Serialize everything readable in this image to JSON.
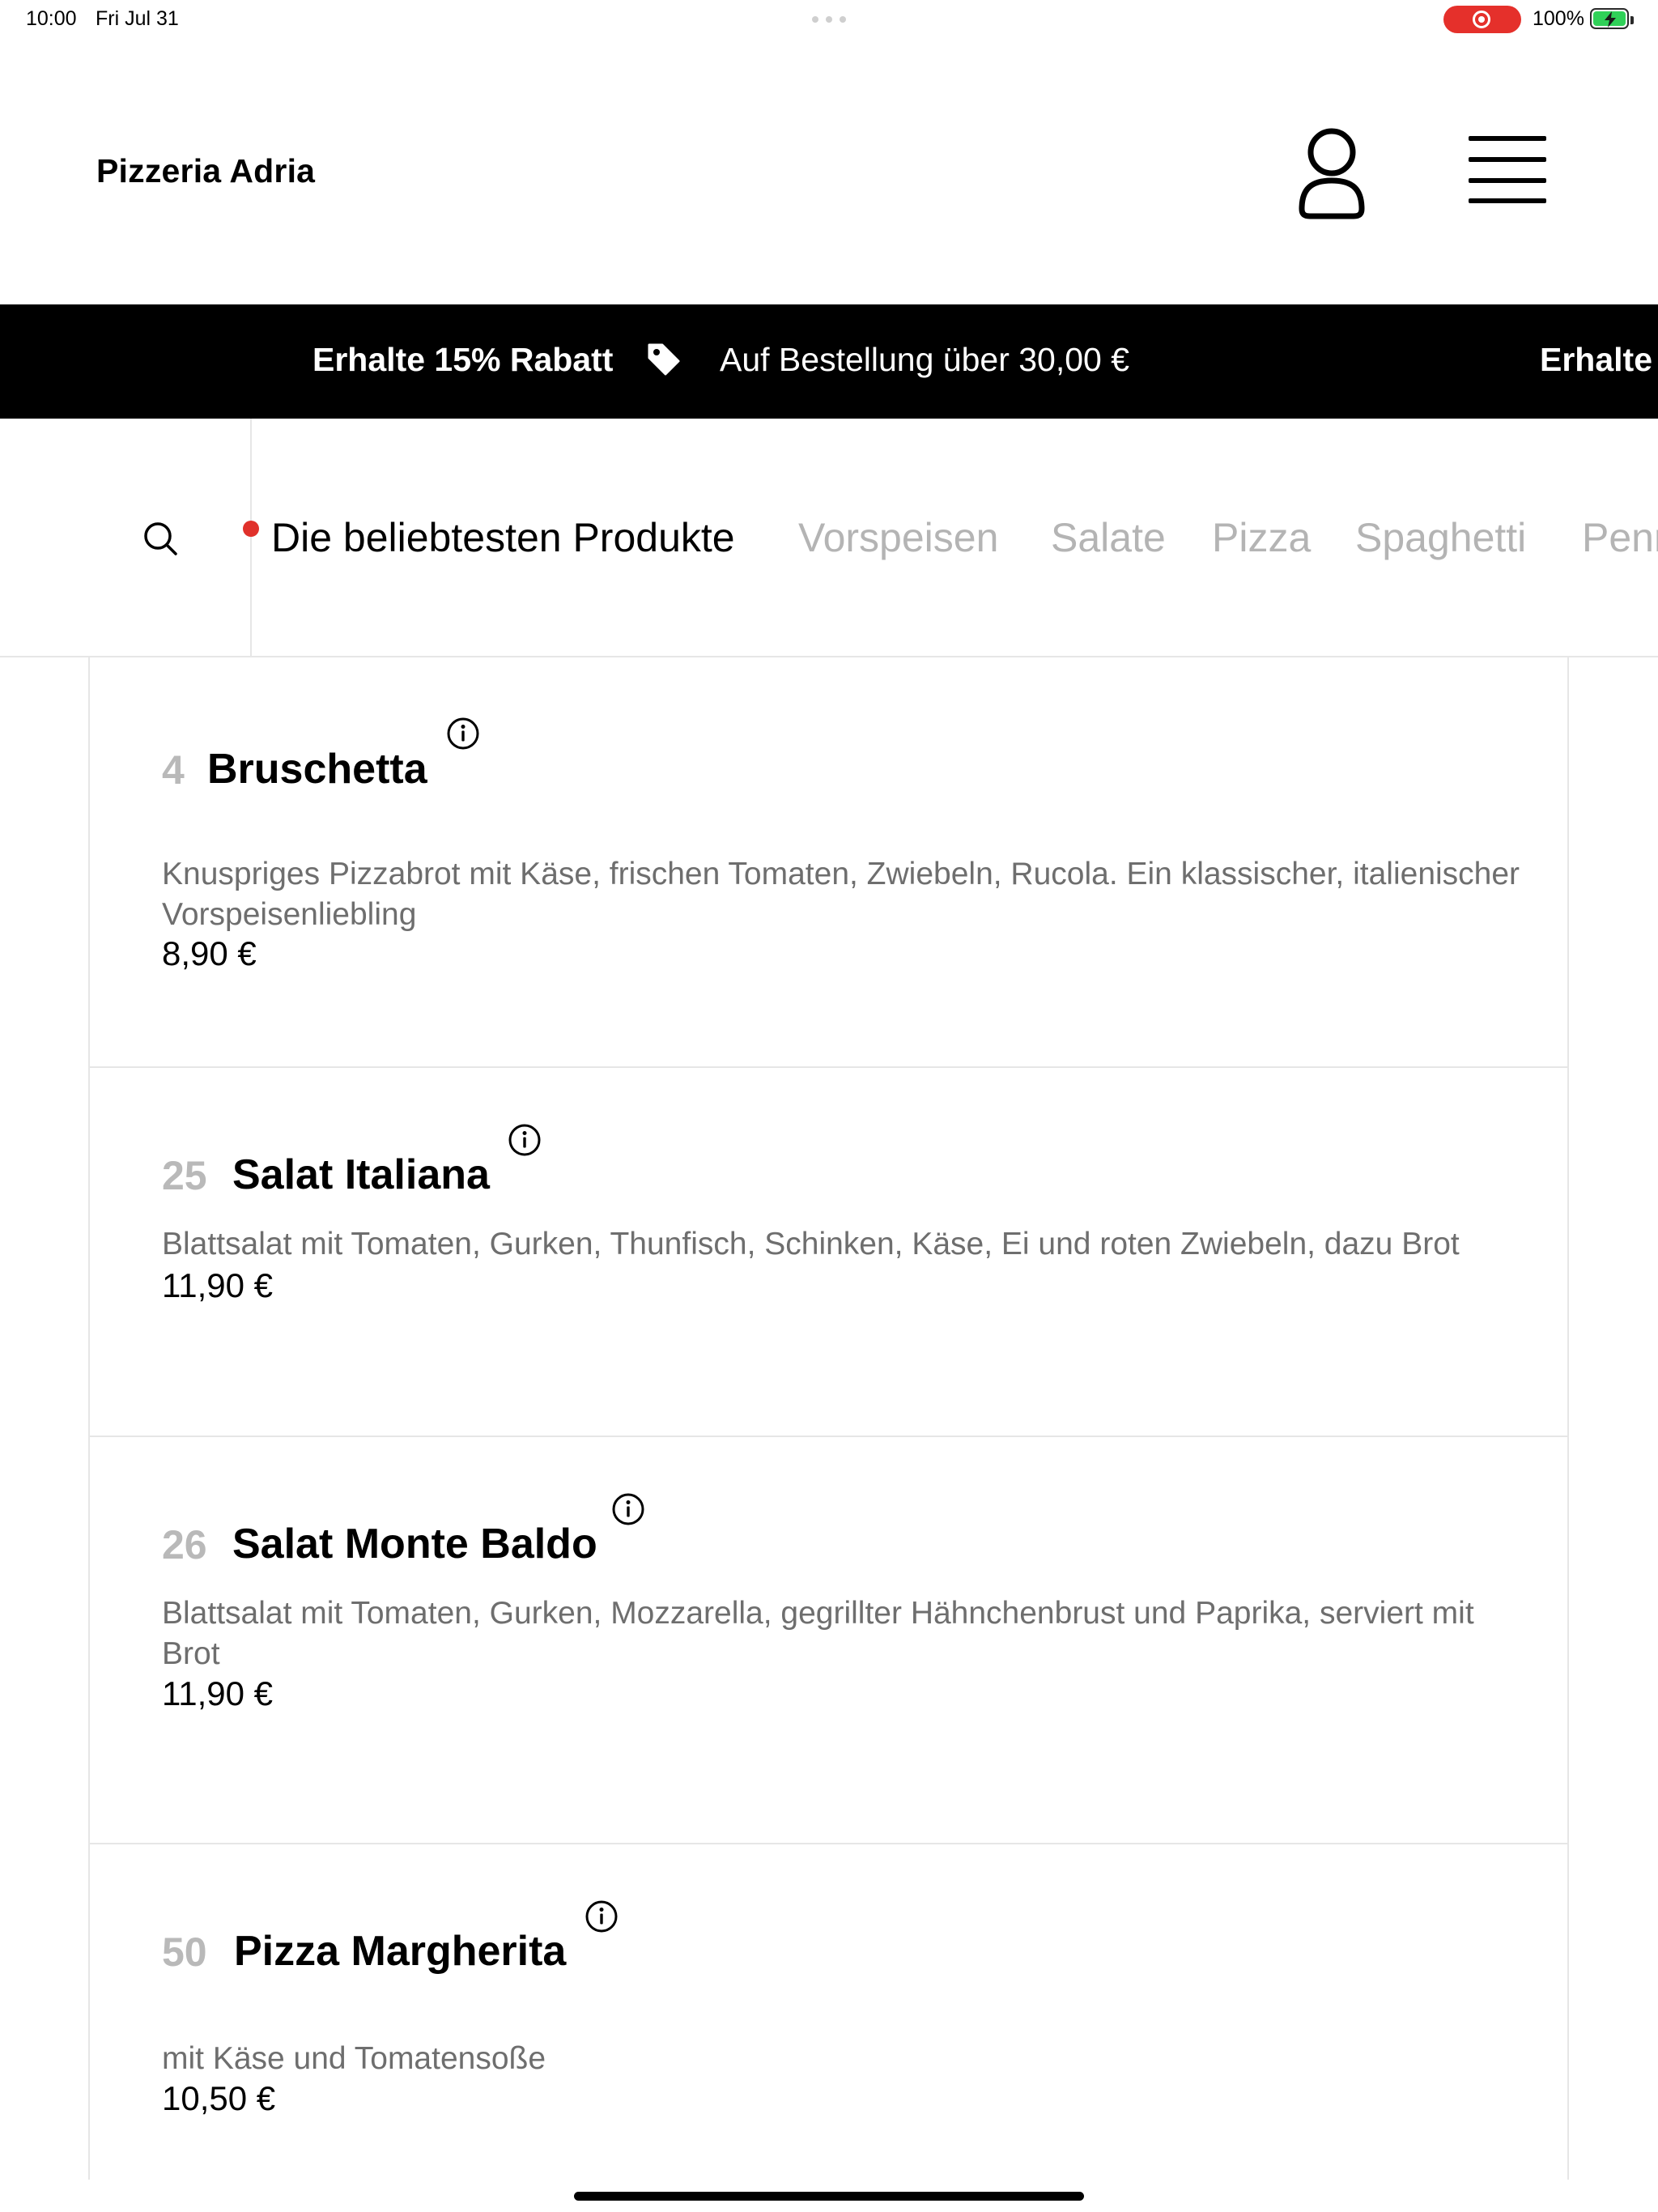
{
  "status_bar": {
    "time": "10:00",
    "date": "Fri Jul 31",
    "battery": "100%"
  },
  "header": {
    "brand": "Pizzeria Adria",
    "account_icon": "user-icon",
    "menu_icon": "hamburger-icon"
  },
  "promo": {
    "headline": "Erhalte 15% Rabatt",
    "condition": "Auf Bestellung über 30,00 €",
    "headline_repeat": "Erhalte",
    "icon": "tag-icon"
  },
  "categories": {
    "search_icon": "search-icon",
    "items": [
      {
        "label": "Die beliebtesten Produkte",
        "active": true
      },
      {
        "label": "Vorspeisen",
        "active": false
      },
      {
        "label": "Salate",
        "active": false
      },
      {
        "label": "Pizza",
        "active": false
      },
      {
        "label": "Spaghetti",
        "active": false
      },
      {
        "label": "Penne",
        "active": false
      }
    ]
  },
  "products": [
    {
      "number": "4",
      "name": "Bruschetta",
      "description": "Knuspriges Pizzabrot mit Käse, frischen Tomaten, Zwiebeln, Rucola. Ein klassischer, italienischer Vorspeisenliebling",
      "price": "8,90 €"
    },
    {
      "number": "25",
      "name": "Salat Italiana",
      "description": "Blattsalat mit Tomaten, Gurken, Thunfisch, Schinken, Käse, Ei und roten Zwiebeln, dazu Brot",
      "price": "11,90 €"
    },
    {
      "number": "26",
      "name": "Salat Monte Baldo",
      "description": "Blattsalat mit Tomaten, Gurken, Mozzarella, gegrillter Hähnchenbrust und Paprika, serviert mit Brot",
      "price": "11,90 €"
    },
    {
      "number": "50",
      "name": "Pizza Margherita",
      "description": "mit Käse und Tomatensoße",
      "price": "10,50 €"
    }
  ],
  "colors": {
    "accent_red": "#e0312b",
    "banner_bg": "#000000",
    "muted_text": "#6e6e6e",
    "inactive_category": "#b4b4b4",
    "battery_green": "#30d158"
  }
}
